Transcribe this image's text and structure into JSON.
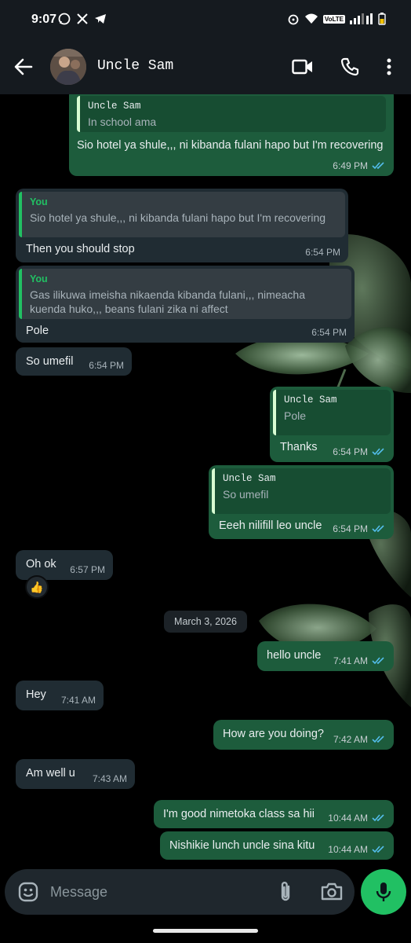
{
  "status_bar": {
    "time": "9:07",
    "network_badge": "VoLTE",
    "icons": [
      "whatsapp-icon",
      "x-icon",
      "telegram-icon",
      "alarm-icon",
      "wifi-icon",
      "signal-icon",
      "battery-icon"
    ]
  },
  "header": {
    "contact_name": "Uncle Sam",
    "icons": [
      "back-arrow-icon",
      "video-call-icon",
      "phone-icon",
      "more-vert-icon"
    ]
  },
  "messages": [
    {
      "dir": "out",
      "quote_name": "Uncle Sam",
      "quote_text": "In school ama",
      "text": "Sio hotel ya shule,,, ni kibanda fulani hapo but I'm recovering",
      "time": "6:49 PM",
      "ticks": true
    },
    {
      "dir": "in",
      "quote_name": "You",
      "quote_text": "Sio hotel ya shule,,, ni kibanda fulani hapo but I'm recovering",
      "text": "Then you should stop",
      "time": "6:54 PM"
    },
    {
      "dir": "in",
      "quote_name": "You",
      "quote_text": "Gas ilikuwa imeisha nikaenda kibanda fulani,,, nimeacha kuenda huko,,, beans fulani zika ni affect",
      "text": "Pole",
      "time": "6:54 PM"
    },
    {
      "dir": "in",
      "text": "So umefil",
      "time": "6:54 PM"
    },
    {
      "dir": "out",
      "quote_name": "Uncle Sam",
      "quote_text": "Pole",
      "text": "Thanks",
      "time": "6:54 PM",
      "ticks": true
    },
    {
      "dir": "out",
      "quote_name": "Uncle Sam",
      "quote_text": "So umefil",
      "text": "Eeeh nilifill leo uncle",
      "time": "6:54 PM",
      "ticks": true
    },
    {
      "dir": "in",
      "text": "Oh ok",
      "time": "6:57 PM",
      "reaction": "👍"
    },
    {
      "dir": "out",
      "text": "hello uncle",
      "time": "7:41 AM",
      "ticks": true
    },
    {
      "dir": "in",
      "text": "Hey",
      "time": "7:41 AM"
    },
    {
      "dir": "out",
      "text": "How are you doing?",
      "time": "7:42 AM",
      "ticks": true
    },
    {
      "dir": "in",
      "text": "Am well u",
      "time": "7:43 AM"
    },
    {
      "dir": "out",
      "text": "I'm good nimetoka class sa hii",
      "time": "10:44 AM",
      "ticks": true
    },
    {
      "dir": "out",
      "text": "Nishikie lunch uncle sina kitu",
      "time": "10:44 AM",
      "ticks": true
    }
  ],
  "date_separator": "March 3, 2026",
  "composer": {
    "placeholder": "Message",
    "icons": [
      "emoji-icon",
      "attach-icon",
      "camera-icon",
      "mic-icon"
    ]
  },
  "colors": {
    "outgoing": "#1d5c3c",
    "incoming": "#202c33",
    "accent": "#21c063",
    "read_ticks": "#53bdeb",
    "header": "#151a1f"
  }
}
